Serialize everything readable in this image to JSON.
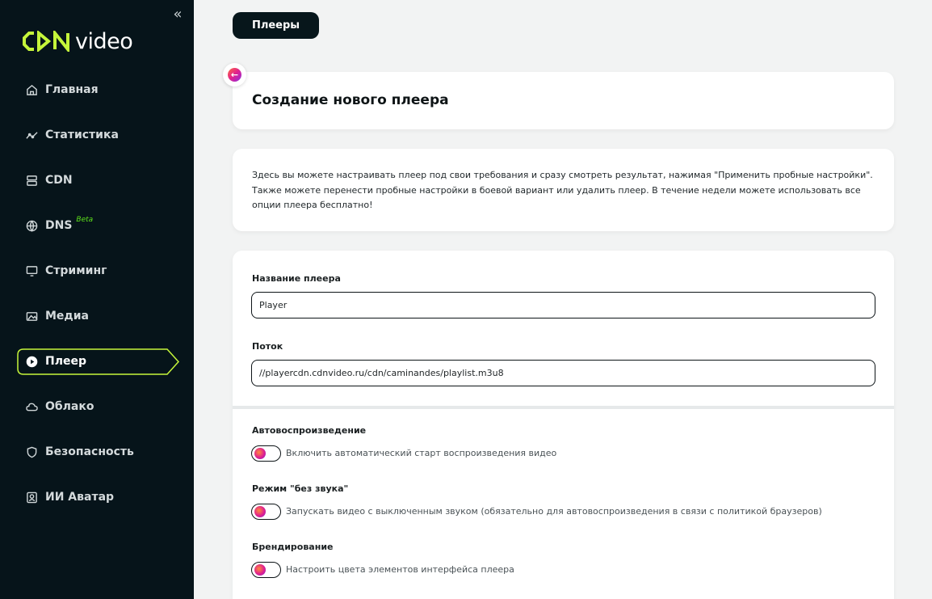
{
  "sidebar": {
    "logo_text": "video",
    "collapse_glyph": "«",
    "items": [
      {
        "label": "Главная",
        "icon": "home-icon"
      },
      {
        "label": "Статистика",
        "icon": "stats-icon"
      },
      {
        "label": "CDN",
        "icon": "server-icon"
      },
      {
        "label": "DNS",
        "icon": "dns-icon",
        "badge": "Beta"
      },
      {
        "label": "Стриминг",
        "icon": "monitor-icon"
      },
      {
        "label": "Медиа",
        "icon": "media-icon"
      },
      {
        "label": "Плеер",
        "icon": "play-icon",
        "active": true
      },
      {
        "label": "Облако",
        "icon": "cloud-icon"
      },
      {
        "label": "Безопасность",
        "icon": "shield-icon"
      },
      {
        "label": "ИИ Аватар",
        "icon": "avatar-icon"
      }
    ]
  },
  "header": {
    "players_button": "Плееры"
  },
  "page": {
    "title": "Создание нового плеера",
    "description": "Здесь вы можете настраивать плеер под свои требования и сразу смотреть результат, нажимая \"Применить пробные настройки\". Также можете перенести пробные настройки в боевой вариант или удалить плеер. В течение недели можете использовать все опции плеера бесплатно!"
  },
  "form": {
    "name_label": "Название плеера",
    "name_value": "Player",
    "stream_label": "Поток",
    "stream_value": "//playercdn.cdnvideo.ru/cdn/caminandes/playlist.m3u8",
    "autoplay_label": "Автовоспроизведение",
    "autoplay_desc": "Включить автоматический старт воспроизведения видео",
    "muted_label": "Режим \"без звука\"",
    "muted_desc": "Запускать видео с выключенным звуком (обязательно для автовоспроизведения в связи с политикой браузеров)",
    "branding_label": "Брендирование",
    "branding_desc": "Настроить цвета элементов интерфейса плеера"
  },
  "colors": {
    "sidebar_bg": "#06141a",
    "accent_green": "#c5f53a",
    "page_bg": "#f2f3f3"
  }
}
